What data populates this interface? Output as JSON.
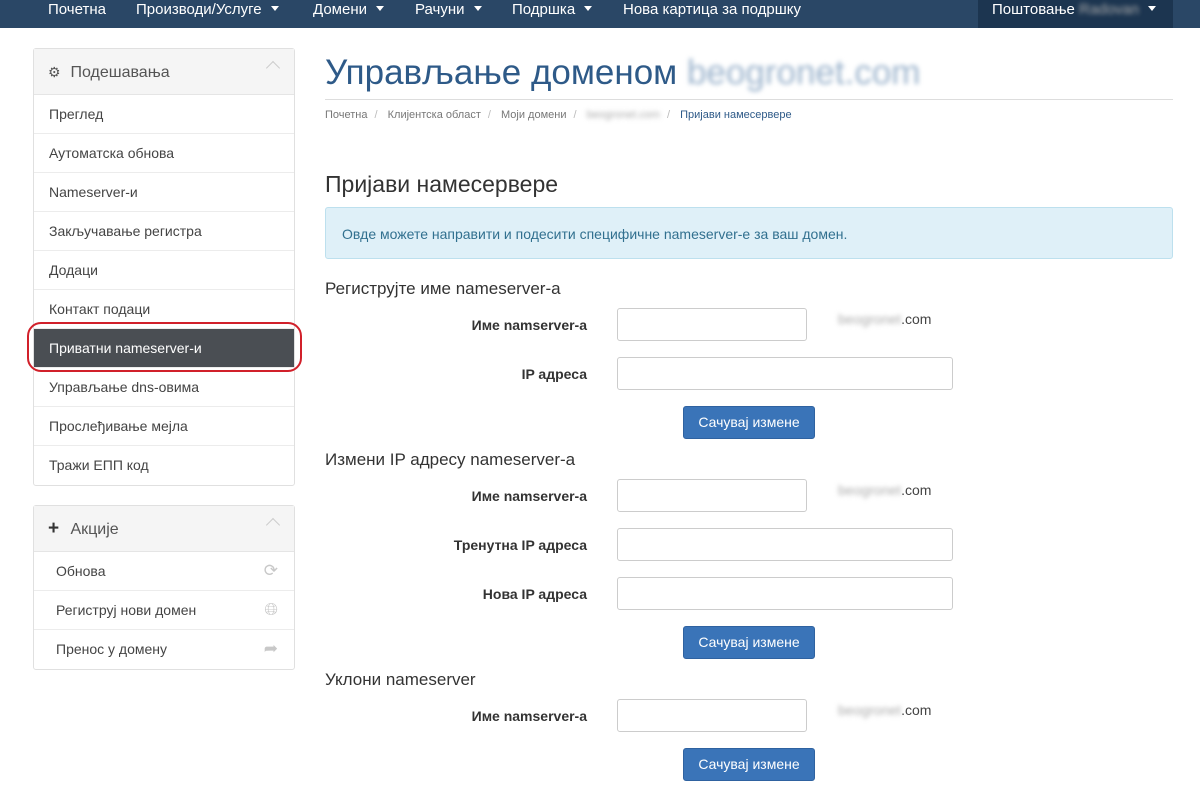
{
  "nav": {
    "items": [
      {
        "label": "Почетна",
        "has_caret": false
      },
      {
        "label": "Производи/Услуге",
        "has_caret": true
      },
      {
        "label": "Домени",
        "has_caret": true
      },
      {
        "label": "Рачуни",
        "has_caret": true
      },
      {
        "label": "Подршка",
        "has_caret": true
      },
      {
        "label": "Нова картица за подршку",
        "has_caret": false
      }
    ],
    "user_greeting": "Поштовање",
    "user_name": "Radovan"
  },
  "sidebar": {
    "settings": {
      "title": "Подешавања",
      "icon": "gear-icon",
      "items": [
        {
          "label": "Преглед"
        },
        {
          "label": "Аутоматска обнова"
        },
        {
          "label": "Nameserver-и"
        },
        {
          "label": "Закључавање регистра"
        },
        {
          "label": "Додаци"
        },
        {
          "label": "Контакт подаци"
        },
        {
          "label": "Приватни nameserver-и",
          "active": true
        },
        {
          "label": "Управљање dns-овима"
        },
        {
          "label": "Прослеђивање мејла"
        },
        {
          "label": "Тражи ЕПП код"
        }
      ]
    },
    "actions": {
      "title": "Акције",
      "icon": "plus-icon",
      "items": [
        {
          "label": "Обнова",
          "icon": "refresh-icon"
        },
        {
          "label": "Региструј нови домен",
          "icon": "globe-icon"
        },
        {
          "label": "Пренос у домену",
          "icon": "share-arrow-icon"
        }
      ]
    }
  },
  "main": {
    "title": "Управљање доменом",
    "domain": "beogronet.com",
    "breadcrumb": [
      "Почетна",
      "Клијентска област",
      "Моји домени",
      "beogronet.com",
      "Пријави намесервере"
    ],
    "section_title": "Пријави намесервере",
    "alert": "Овде можете направити и подесити специфичне nameserver-е за ваш домен.",
    "domain_suffix_blur": "beogronet",
    "domain_suffix_tld": ".com",
    "register": {
      "title": "Региструјте име nameserver-а",
      "name_label": "Име namserver-а",
      "ip_label": "IP адреса",
      "save": "Сачувај измене"
    },
    "modify": {
      "title": "Измени IP адресу nameserver-а",
      "name_label": "Име namserver-а",
      "current_ip_label": "Тренутна IP адреса",
      "new_ip_label": "Нова IP адреса",
      "save": "Сачувај измене"
    },
    "remove": {
      "title": "Уклони nameserver",
      "name_label": "Име namserver-а",
      "save": "Сачувај измене"
    }
  },
  "colors": {
    "nav_bg": "#2a4766",
    "accent": "#2e5a88",
    "button": "#3a74b8",
    "active_item": "#4a4e53",
    "highlight": "#d1202a"
  }
}
